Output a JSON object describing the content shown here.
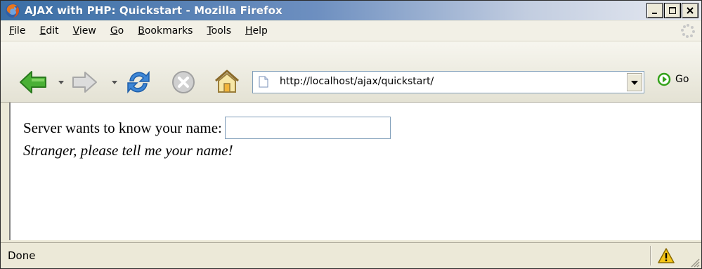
{
  "window": {
    "title": "AJAX with PHP: Quickstart - Mozilla Firefox",
    "controls": [
      "minimize",
      "maximize",
      "close"
    ]
  },
  "menu": {
    "items": [
      {
        "label": "File",
        "accel": "F"
      },
      {
        "label": "Edit",
        "accel": "E"
      },
      {
        "label": "View",
        "accel": "V"
      },
      {
        "label": "Go",
        "accel": "G"
      },
      {
        "label": "Bookmarks",
        "accel": "B"
      },
      {
        "label": "Tools",
        "accel": "T"
      },
      {
        "label": "Help",
        "accel": "H"
      }
    ]
  },
  "toolbar": {
    "icons": [
      "back-arrow-icon",
      "forward-arrow-icon",
      "reload-icon",
      "stop-icon",
      "home-icon"
    ],
    "url": "http://localhost/ajax/quickstart/",
    "go_label": "Go"
  },
  "content": {
    "prompt_label": "Server wants to know your name:",
    "name_value": "",
    "message": "Stranger, please tell me your name!"
  },
  "status": {
    "text": "Done"
  },
  "colors": {
    "titlebar": "#3a6ea5",
    "chrome": "#ece9d8",
    "back_green": "#3fa52c",
    "go_green": "#34a21a"
  }
}
